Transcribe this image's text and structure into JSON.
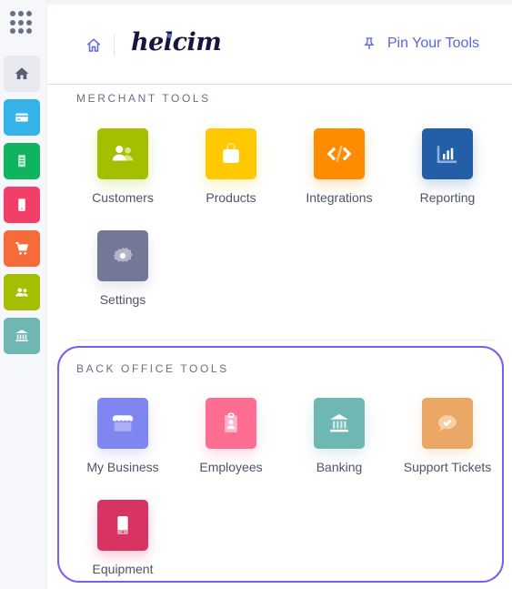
{
  "sidebar": {
    "apps_button": "apps-grid",
    "items": [
      {
        "name": "home",
        "icon": "home-icon",
        "color": "#e9eaef"
      },
      {
        "name": "payments",
        "icon": "credit-card-icon",
        "color": "#35b3e8"
      },
      {
        "name": "invoices",
        "icon": "receipt-icon",
        "color": "#10b35e"
      },
      {
        "name": "terminal",
        "icon": "mobile-icon",
        "color": "#f23f6a"
      },
      {
        "name": "commerce",
        "icon": "cart-icon",
        "color": "#f76b3b"
      },
      {
        "name": "customers",
        "icon": "users-icon",
        "color": "#a5be00"
      },
      {
        "name": "banking",
        "icon": "bank-icon",
        "color": "#6fb7b3"
      }
    ]
  },
  "header": {
    "logo": "helcim",
    "pin_label": "Pin Your Tools",
    "accent": "#5b63e6"
  },
  "merchant_tools": {
    "title": "MERCHANT TOOLS",
    "items": [
      {
        "label": "Customers",
        "icon": "users-icon",
        "color": "#a5be00"
      },
      {
        "label": "Products",
        "icon": "shopping-bag-icon",
        "color": "#ffc800"
      },
      {
        "label": "Integrations",
        "icon": "code-icon",
        "color": "#ff8c00"
      },
      {
        "label": "Reporting",
        "icon": "bar-chart-icon",
        "color": "#235fa6"
      },
      {
        "label": "Settings",
        "icon": "gear-icon",
        "color": "#737896"
      }
    ]
  },
  "back_office_tools": {
    "title": "BACK OFFICE TOOLS",
    "highlight_color": "#7b5cf0",
    "items": [
      {
        "label": "My Business",
        "icon": "storefront-icon",
        "color": "#7f86f1"
      },
      {
        "label": "Employees",
        "icon": "id-badge-icon",
        "color": "#ff6d92"
      },
      {
        "label": "Banking",
        "icon": "bank-icon",
        "color": "#6fb7b3"
      },
      {
        "label": "Support Tickets",
        "icon": "chat-check-icon",
        "color": "#eba766"
      },
      {
        "label": "Equipment",
        "icon": "tablet-icon",
        "color": "#d83463"
      }
    ]
  }
}
